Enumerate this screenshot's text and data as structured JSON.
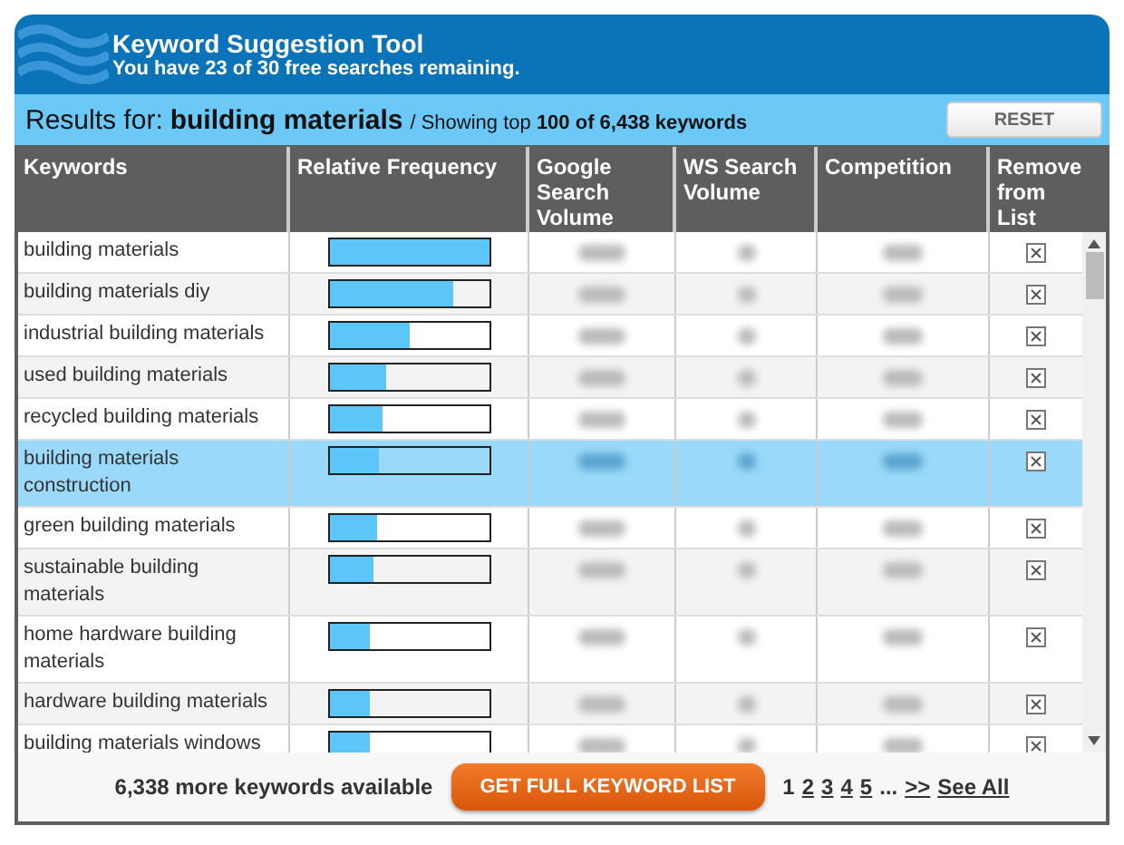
{
  "header": {
    "title": "Keyword Suggestion Tool",
    "subtitle": "You have 23 of 30 free searches remaining."
  },
  "results_bar": {
    "label": "Results for:",
    "query": "building materials",
    "summary": "/ Showing top **100 of 6,438 keywords**",
    "reset_button": "RESET"
  },
  "table": {
    "columns": [
      "Keywords",
      "Relative Frequency",
      "Google Search Volume",
      "WS Search Volume",
      "Competition",
      "Remove from List"
    ],
    "rows": [
      {
        "keyword": "building materials",
        "level": 1.0,
        "selected": false
      },
      {
        "keyword": "building materials diy",
        "level": 0.78,
        "selected": false
      },
      {
        "keyword": "industrial building materials",
        "level": 0.51,
        "selected": false
      },
      {
        "keyword": "used building materials",
        "level": 0.36,
        "selected": false
      },
      {
        "keyword": "recycled building materials",
        "level": 0.33,
        "selected": false
      },
      {
        "keyword": "building materials construction",
        "level": 0.31,
        "selected": true
      },
      {
        "keyword": "green building materials",
        "level": 0.3,
        "selected": false
      },
      {
        "keyword": "sustainable building materials",
        "level": 0.28,
        "selected": false
      },
      {
        "keyword": "home hardware building materials",
        "level": 0.26,
        "selected": false
      },
      {
        "keyword": "hardware building materials",
        "level": 0.25,
        "selected": false
      },
      {
        "keyword": "building materials windows",
        "level": 0.25,
        "selected": false
      }
    ]
  },
  "footer": {
    "more": "6,338 more keywords available",
    "cta_button": "GET FULL KEYWORD LIST",
    "pages": [
      {
        "label": "1",
        "selected": true
      },
      {
        "label": "2",
        "selected": false
      },
      {
        "label": "3",
        "selected": false
      },
      {
        "label": "4",
        "selected": false
      },
      {
        "label": "5",
        "selected": false
      }
    ],
    "ellipsis": "...",
    "next": ">>",
    "see_all": "See All"
  }
}
